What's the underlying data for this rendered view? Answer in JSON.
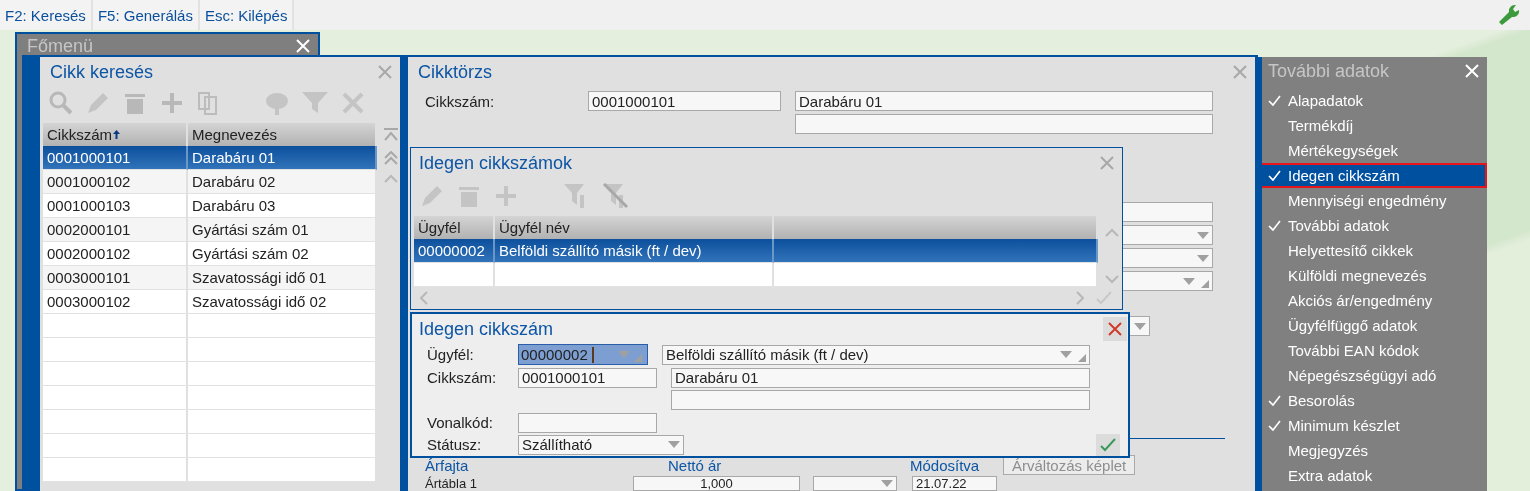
{
  "shortcut_bar": {
    "shortcuts": [
      "F2: Keresés",
      "F5: Generálás",
      "Esc: Kilépés"
    ]
  },
  "main_menu": {
    "title": "Főmenü"
  },
  "article_search": {
    "title": "Cikk keresés",
    "columns": [
      {
        "label": "Cikkszám",
        "sorted": true
      },
      {
        "label": "Megnevezés",
        "sorted": false
      }
    ],
    "rows": [
      {
        "cells": [
          "0001000101",
          "Darabáru 01"
        ],
        "selected": true
      },
      {
        "cells": [
          "0001000102",
          "Darabáru 02"
        ],
        "selected": false
      },
      {
        "cells": [
          "0001000103",
          "Darabáru 03"
        ],
        "selected": false
      },
      {
        "cells": [
          "0002000101",
          "Gyártási szám 01"
        ],
        "selected": false
      },
      {
        "cells": [
          "0002000102",
          "Gyártási szám 02"
        ],
        "selected": false
      },
      {
        "cells": [
          "0003000101",
          "Szavatossági idő 01"
        ],
        "selected": false
      },
      {
        "cells": [
          "0003000102",
          "Szavatossági idő 02"
        ],
        "selected": false
      }
    ]
  },
  "article_master": {
    "title": "Cikktörzs",
    "article_number_label": "Cikkszám:",
    "article_number": "0001000101",
    "article_name": "Darabáru 01",
    "price_columns": [
      "Árfajta",
      "Nettó ár",
      "Módosítva"
    ],
    "price_formula_button": {
      "label": "Árváltozás képlet",
      "disabled": true
    },
    "price_rows": [
      {
        "label": "Ártábla 1",
        "net_price": "1,000",
        "modified": "21.07.22"
      }
    ]
  },
  "foreign_numbers_list": {
    "title": "Idegen cikkszámok",
    "columns": [
      "Ügyfél",
      "Ügyfél név"
    ],
    "rows": [
      {
        "cells": [
          "00000002",
          "Belföldi szállító másik (ft / dev)"
        ],
        "selected": true
      }
    ]
  },
  "foreign_number_form": {
    "title": "Idegen cikkszám",
    "customer": {
      "label": "Ügyfél:",
      "code": "00000002",
      "name": "Belföldi szállító másik (ft / dev)"
    },
    "article": {
      "label": "Cikkszám:",
      "number": "0001000101",
      "name": "Darabáru 01"
    },
    "barcode": {
      "label": "Vonalkód:"
    },
    "status": {
      "label": "Státusz:",
      "value": "Szállítható"
    }
  },
  "more_data": {
    "title": "További adatok",
    "items": [
      {
        "label": "Alapadatok",
        "checked": true,
        "selected": false
      },
      {
        "label": "Termékdíj",
        "checked": false,
        "selected": false
      },
      {
        "label": "Mértékegységek",
        "checked": false,
        "selected": false
      },
      {
        "label": "Idegen cikkszám",
        "checked": true,
        "selected": true
      },
      {
        "label": "Mennyiségi engedmény",
        "checked": false,
        "selected": false
      },
      {
        "label": "További adatok",
        "checked": true,
        "selected": false
      },
      {
        "label": "Helyettesítő cikkek",
        "checked": false,
        "selected": false
      },
      {
        "label": "Külföldi megnevezés",
        "checked": false,
        "selected": false
      },
      {
        "label": "Akciós ár/engedmény",
        "checked": false,
        "selected": false
      },
      {
        "label": "Ügyfélfüggő adatok",
        "checked": false,
        "selected": false
      },
      {
        "label": "További EAN kódok",
        "checked": false,
        "selected": false
      },
      {
        "label": "Népegészségügyi adó",
        "checked": false,
        "selected": false
      },
      {
        "label": "Besorolás",
        "checked": true,
        "selected": false
      },
      {
        "label": "Minimum készlet",
        "checked": true,
        "selected": false
      },
      {
        "label": "Megjegyzés",
        "checked": false,
        "selected": false
      },
      {
        "label": "Extra adatok",
        "checked": false,
        "selected": false
      }
    ]
  }
}
